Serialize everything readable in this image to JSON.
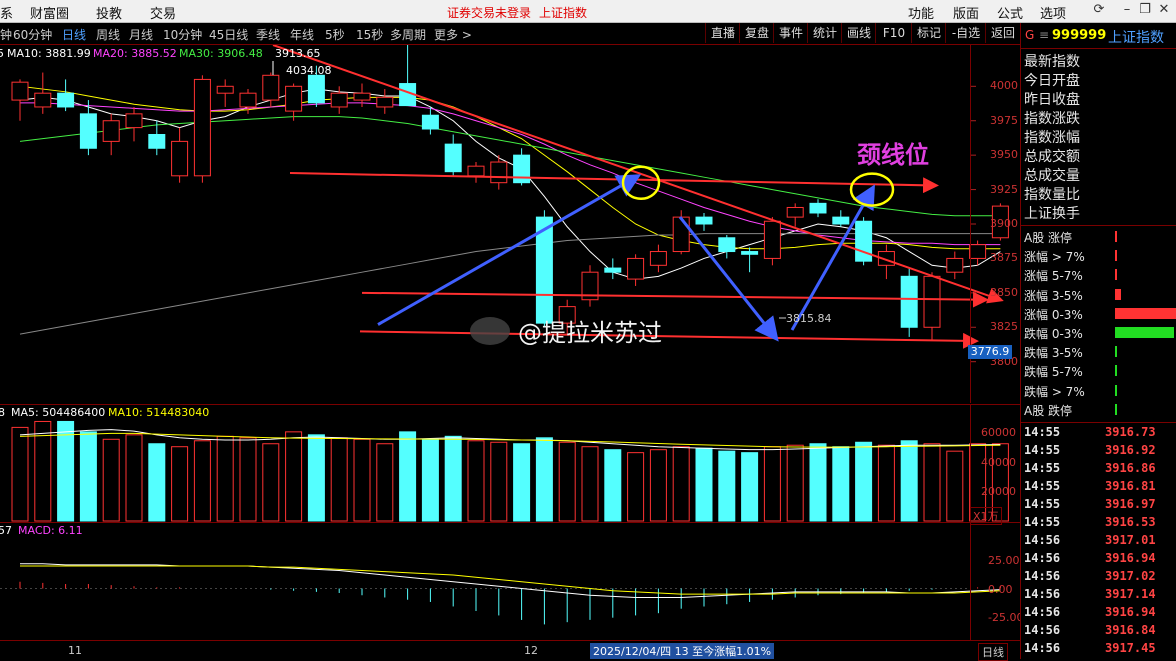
{
  "menu": {
    "items": [
      "系",
      "财富圈",
      "投教",
      "交易"
    ],
    "notice_left": "证券交易未登录",
    "notice_right": "上证指数",
    "right_items": [
      "功能",
      "版面",
      "公式",
      "选项"
    ],
    "sys_icons": [
      "refresh-icon",
      "minimize-icon",
      "restore-icon",
      "close-icon"
    ]
  },
  "periods": [
    "钟",
    "60分钟",
    "日线",
    "周线",
    "月线",
    "10分钟",
    "45日线",
    "季线",
    "年线",
    "5秒",
    "15秒",
    "多周期",
    "更多 >"
  ],
  "active_period": "日线",
  "toolbar": [
    "直播",
    "复盘",
    "事件",
    "统计",
    "画线",
    "F10",
    "标记",
    "-自选",
    "返回"
  ],
  "price_chart": {
    "ma_labels": [
      {
        "text": "5",
        "color": "#ffffff"
      },
      {
        "text": "MA10: 3881.99",
        "color": "#ffffff"
      },
      {
        "text": "MA20: 3885.52",
        "color": "#ff44ff"
      },
      {
        "text": "MA30: 3906.48",
        "color": "#44ee44"
      },
      {
        "text": "3913.65",
        "color": "#ffffff"
      }
    ],
    "high_label": "4034.08",
    "low_label": "3815.84",
    "axis_ticks": [
      "4000",
      "3975",
      "3950",
      "3925",
      "3900",
      "3875",
      "3850",
      "3825",
      "3800"
    ],
    "current_price_box": "3776.9",
    "annotation": "颈线位",
    "watermark": "@提拉米苏过"
  },
  "volume_chart": {
    "labels": [
      {
        "text": "8",
        "color": "#ffffff"
      },
      {
        "text": "MA5: 504486400",
        "color": "#ffffff"
      },
      {
        "text": "MA10: 514483040",
        "color": "#ffff00"
      }
    ],
    "axis_ticks": [
      "60000",
      "40000",
      "20000"
    ],
    "unit": "X1万"
  },
  "macd_chart": {
    "labels": [
      {
        "text": "57",
        "color": "#ffffff"
      },
      {
        "text": "MACD: 6.11",
        "color": "#ff44ff"
      }
    ],
    "axis_ticks": [
      "25.00",
      "0.00",
      "-25.00"
    ]
  },
  "date_axis": {
    "month1": "11",
    "month2": "12",
    "info": "2025/12/04/四 13 至今涨幅1.01%",
    "tab": "日线"
  },
  "right_panel": {
    "code_prefix": "G",
    "code": "999999",
    "name": "上证指数",
    "fields": [
      "最新指数",
      "今日开盘",
      "昨日收盘",
      "指数涨跌",
      "指数涨幅",
      "总成交额",
      "总成交量",
      "指数量比",
      "上证换手"
    ],
    "breadth": [
      {
        "label": "A股 涨停",
        "level": 0.02,
        "color": "#ff3333"
      },
      {
        "label": "涨幅 > 7%",
        "level": 0.02,
        "color": "#ff3333"
      },
      {
        "label": "涨幅 5-7%",
        "level": 0.03,
        "color": "#ff3333"
      },
      {
        "label": "涨幅 3-5%",
        "level": 0.1,
        "color": "#ff3333"
      },
      {
        "label": "涨幅 0-3%",
        "level": 1.0,
        "color": "#ff3333"
      },
      {
        "label": "跌幅 0-3%",
        "level": 0.95,
        "color": "#22dd22"
      },
      {
        "label": "跌幅 3-5%",
        "level": 0.04,
        "color": "#22dd22"
      },
      {
        "label": "跌幅 5-7%",
        "level": 0.01,
        "color": "#22dd22"
      },
      {
        "label": "跌幅 > 7%",
        "level": 0.01,
        "color": "#22dd22"
      },
      {
        "label": "A股 跌停",
        "level": 0.01,
        "color": "#22dd22"
      }
    ],
    "ticks": [
      {
        "time": "14:55",
        "price": "3916.73"
      },
      {
        "time": "14:55",
        "price": "3916.92"
      },
      {
        "time": "14:55",
        "price": "3916.86"
      },
      {
        "time": "14:55",
        "price": "3916.81"
      },
      {
        "time": "14:55",
        "price": "3916.97"
      },
      {
        "time": "14:55",
        "price": "3916.53"
      },
      {
        "time": "14:56",
        "price": "3917.01"
      },
      {
        "time": "14:56",
        "price": "3916.94"
      },
      {
        "time": "14:56",
        "price": "3917.02"
      },
      {
        "time": "14:56",
        "price": "3917.14"
      },
      {
        "time": "14:56",
        "price": "3916.94"
      },
      {
        "time": "14:56",
        "price": "3916.84"
      },
      {
        "time": "14:56",
        "price": "3917.45"
      }
    ]
  },
  "chart_data": {
    "type": "candlestick",
    "y_range": [
      3770,
      4030
    ],
    "candles": [
      {
        "o": 3990,
        "h": 4005,
        "l": 3975,
        "c": 4003
      },
      {
        "o": 3985,
        "h": 4010,
        "l": 3980,
        "c": 3995
      },
      {
        "o": 3995,
        "h": 4005,
        "l": 3982,
        "c": 3985
      },
      {
        "o": 3980,
        "h": 3990,
        "l": 3950,
        "c": 3955
      },
      {
        "o": 3960,
        "h": 3980,
        "l": 3950,
        "c": 3975
      },
      {
        "o": 3970,
        "h": 3985,
        "l": 3960,
        "c": 3980
      },
      {
        "o": 3965,
        "h": 3975,
        "l": 3950,
        "c": 3955
      },
      {
        "o": 3935,
        "h": 3970,
        "l": 3930,
        "c": 3960
      },
      {
        "o": 3935,
        "h": 4008,
        "l": 3930,
        "c": 4005
      },
      {
        "o": 3995,
        "h": 4005,
        "l": 3985,
        "c": 4000
      },
      {
        "o": 3985,
        "h": 3998,
        "l": 3980,
        "c": 3995
      },
      {
        "o": 3990,
        "h": 4010,
        "l": 3985,
        "c": 4008
      },
      {
        "o": 3982,
        "h": 4002,
        "l": 3975,
        "c": 4000
      },
      {
        "o": 4008,
        "h": 4015,
        "l": 3985,
        "c": 3988
      },
      {
        "o": 3985,
        "h": 4000,
        "l": 3980,
        "c": 3995
      },
      {
        "o": 3990,
        "h": 4002,
        "l": 3985,
        "c": 3995
      },
      {
        "o": 3985,
        "h": 3998,
        "l": 3980,
        "c": 3992
      },
      {
        "o": 4002,
        "h": 4034,
        "l": 3990,
        "c": 3986
      },
      {
        "o": 3979,
        "h": 3985,
        "l": 3965,
        "c": 3969
      },
      {
        "o": 3958,
        "h": 3965,
        "l": 3935,
        "c": 3938
      },
      {
        "o": 3935,
        "h": 3945,
        "l": 3930,
        "c": 3942
      },
      {
        "o": 3930,
        "h": 3950,
        "l": 3925,
        "c": 3945
      },
      {
        "o": 3950,
        "h": 3955,
        "l": 3928,
        "c": 3930
      },
      {
        "o": 3905,
        "h": 3910,
        "l": 3825,
        "c": 3828
      },
      {
        "o": 3828,
        "h": 3845,
        "l": 3820,
        "c": 3840
      },
      {
        "o": 3845,
        "h": 3870,
        "l": 3840,
        "c": 3865
      },
      {
        "o": 3868,
        "h": 3875,
        "l": 3860,
        "c": 3865
      },
      {
        "o": 3860,
        "h": 3878,
        "l": 3855,
        "c": 3875
      },
      {
        "o": 3870,
        "h": 3885,
        "l": 3865,
        "c": 3880
      },
      {
        "o": 3880,
        "h": 3910,
        "l": 3878,
        "c": 3905
      },
      {
        "o": 3905,
        "h": 3908,
        "l": 3895,
        "c": 3900
      },
      {
        "o": 3890,
        "h": 3892,
        "l": 3875,
        "c": 3880
      },
      {
        "o": 3880,
        "h": 3883,
        "l": 3865,
        "c": 3878
      },
      {
        "o": 3875,
        "h": 3905,
        "l": 3870,
        "c": 3902
      },
      {
        "o": 3905,
        "h": 3915,
        "l": 3898,
        "c": 3912
      },
      {
        "o": 3915,
        "h": 3918,
        "l": 3905,
        "c": 3908
      },
      {
        "o": 3905,
        "h": 3910,
        "l": 3898,
        "c": 3900
      },
      {
        "o": 3902,
        "h": 3905,
        "l": 3870,
        "c": 3873
      },
      {
        "o": 3870,
        "h": 3885,
        "l": 3860,
        "c": 3880
      },
      {
        "o": 3862,
        "h": 3868,
        "l": 3818,
        "c": 3825
      },
      {
        "o": 3825,
        "h": 3865,
        "l": 3816,
        "c": 3862
      },
      {
        "o": 3865,
        "h": 3880,
        "l": 3860,
        "c": 3875
      },
      {
        "o": 3875,
        "h": 3888,
        "l": 3870,
        "c": 3885
      },
      {
        "o": 3890,
        "h": 3915,
        "l": 3888,
        "c": 3913
      }
    ],
    "volume": {
      "range": [
        0,
        70000
      ],
      "values": [
        63000,
        67000,
        67000,
        60000,
        55000,
        58000,
        52000,
        50000,
        54000,
        57000,
        56000,
        52000,
        60000,
        58000,
        56000,
        55000,
        52000,
        60000,
        55000,
        57000,
        54000,
        53000,
        52000,
        56000,
        53000,
        50000,
        48000,
        46000,
        48000,
        50000,
        49000,
        47000,
        46000,
        50000,
        51000,
        52000,
        50000,
        53000,
        51000,
        54000,
        52000,
        47000,
        52000,
        52000
      ],
      "ma5": [
        58000,
        59000,
        60000,
        61000,
        61500,
        60500,
        58000,
        56000,
        55000,
        54500,
        54500,
        55000,
        56000,
        56500,
        56000,
        55500,
        55000,
        55000,
        55500,
        56000,
        55500,
        55000,
        54500,
        54500,
        54000,
        53000,
        52000,
        51000,
        50000,
        49500,
        49000,
        48500,
        48000,
        48000,
        48500,
        49000,
        49500,
        50000,
        50500,
        51000,
        51000,
        51000,
        51200,
        51500
      ],
      "ma10": [
        57000,
        57500,
        58000,
        58500,
        59000,
        59000,
        58500,
        58000,
        57500,
        57000,
        56500,
        56000,
        55800,
        55600,
        55500,
        55400,
        55300,
        55200,
        55100,
        55000,
        54900,
        54700,
        54500,
        54300,
        54000,
        53600,
        53200,
        52700,
        52200,
        51700,
        51200,
        50800,
        50400,
        50000,
        49800,
        49700,
        49700,
        49800,
        50000,
        50200,
        50400,
        50600,
        50800,
        51000
      ]
    },
    "macd": {
      "range": [
        -45,
        45
      ],
      "hist": [
        6,
        5,
        4,
        4,
        3,
        2,
        1,
        1,
        0,
        0,
        0,
        -1,
        -2,
        -3,
        -4,
        -6,
        -8,
        -10,
        -12,
        -16,
        -20,
        -24,
        -28,
        -32,
        -30,
        -28,
        -26,
        -24,
        -22,
        -18,
        -16,
        -14,
        -12,
        -10,
        -8,
        -6,
        -5,
        -4,
        -3,
        -2,
        -1,
        0,
        1,
        2
      ],
      "dif": [
        22,
        22,
        21,
        21,
        21,
        21,
        21,
        20,
        20,
        20,
        20,
        19,
        18,
        17,
        16,
        14,
        12,
        10,
        8,
        6,
        4,
        2,
        0,
        -2,
        -4,
        -6,
        -7,
        -8,
        -8,
        -8,
        -7,
        -6,
        -5,
        -4,
        -3,
        -3,
        -3,
        -3,
        -3,
        -4,
        -4,
        -3,
        -2,
        -1
      ],
      "dea": [
        20,
        20,
        20,
        20,
        20,
        20,
        20,
        20,
        20,
        20,
        20,
        19,
        19,
        18,
        17,
        16,
        15,
        14,
        13,
        12,
        10,
        8,
        6,
        4,
        2,
        0,
        -2,
        -3,
        -4,
        -5,
        -5,
        -5,
        -5,
        -5,
        -4,
        -4,
        -4,
        -4,
        -4,
        -4,
        -4,
        -4,
        -3,
        -2
      ]
    },
    "ma_lines": {
      "ma5": [
        3990,
        3992,
        3990,
        3985,
        3980,
        3978,
        3975,
        3970,
        3975,
        3978,
        3985,
        3990,
        3995,
        3998,
        3996,
        3995,
        3993,
        3993,
        3985,
        3975,
        3960,
        3948,
        3940,
        3920,
        3898,
        3880,
        3865,
        3860,
        3862,
        3868,
        3875,
        3880,
        3885,
        3890,
        3895,
        3900,
        3898,
        3895,
        3890,
        3880,
        3870,
        3868,
        3870,
        3880
      ],
      "ma10": [
        4000,
        3998,
        3996,
        3993,
        3990,
        3987,
        3985,
        3983,
        3982,
        3982,
        3983,
        3985,
        3987,
        3990,
        3991,
        3992,
        3992,
        3992,
        3990,
        3985,
        3978,
        3970,
        3962,
        3950,
        3938,
        3925,
        3912,
        3900,
        3892,
        3888,
        3885,
        3883,
        3882,
        3882,
        3883,
        3885,
        3886,
        3886,
        3886,
        3885,
        3883,
        3882,
        3882,
        3882
      ],
      "ma20": [
        3988,
        3988,
        3987,
        3986,
        3985,
        3984,
        3983,
        3982,
        3982,
        3983,
        3984,
        3985,
        3986,
        3987,
        3988,
        3988,
        3987,
        3986,
        3984,
        3980,
        3975,
        3970,
        3965,
        3958,
        3950,
        3943,
        3937,
        3930,
        3924,
        3918,
        3912,
        3907,
        3902,
        3898,
        3895,
        3892,
        3890,
        3888,
        3887,
        3886,
        3886,
        3885,
        3885,
        3885
      ],
      "ma30": [
        3960,
        3962,
        3964,
        3966,
        3968,
        3970,
        3972,
        3973,
        3974,
        3975,
        3976,
        3977,
        3978,
        3978,
        3978,
        3977,
        3975,
        3973,
        3970,
        3967,
        3964,
        3961,
        3958,
        3955,
        3952,
        3949,
        3946,
        3943,
        3940,
        3937,
        3934,
        3931,
        3928,
        3925,
        3922,
        3919,
        3916,
        3913,
        3911,
        3909,
        3907,
        3906,
        3906,
        3906
      ],
      "ma60": [
        3820,
        3823,
        3826,
        3829,
        3832,
        3835,
        3838,
        3841,
        3844,
        3847,
        3850,
        3853,
        3856,
        3859,
        3862,
        3865,
        3868,
        3871,
        3874,
        3877,
        3880,
        3882,
        3884,
        3886,
        3888,
        3889,
        3890,
        3891,
        3892,
        3892,
        3893,
        3893,
        3893,
        3893,
        3893,
        3893,
        3893,
        3893,
        3893,
        3893,
        3893,
        3893,
        3893,
        3893
      ]
    }
  }
}
